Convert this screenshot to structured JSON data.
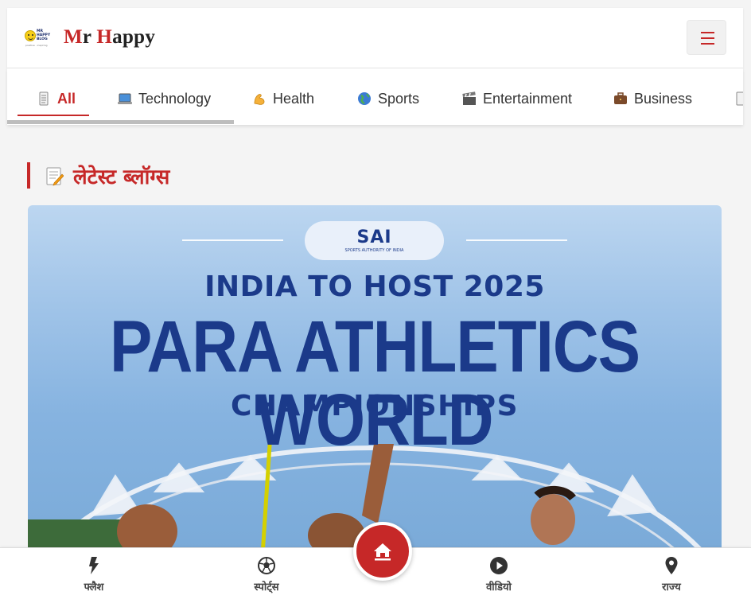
{
  "header": {
    "logo_text": "MR HAPPY BLOG",
    "logo_tagline": "positive · inspiring",
    "brand_first_initial": "M",
    "brand_first_rest": "r ",
    "brand_second_initial": "H",
    "brand_second_rest": "appy",
    "colors": {
      "accent": "#c62828"
    }
  },
  "tabs": [
    {
      "label": "All",
      "icon": "page-icon",
      "active": true
    },
    {
      "label": "Technology",
      "icon": "laptop-icon"
    },
    {
      "label": "Health",
      "icon": "flexed-bicep-icon"
    },
    {
      "label": "Sports",
      "icon": "globe-icon"
    },
    {
      "label": "Entertainment",
      "icon": "clapperboard-icon"
    },
    {
      "label": "Business",
      "icon": "briefcase-icon"
    }
  ],
  "section": {
    "title": "लेटेस्ट ब्लॉग्स",
    "icon": "memo-icon"
  },
  "hero": {
    "badge": "SAI",
    "badge_sub": "SPORTS AUTHORITY OF INDIA",
    "line1": "INDIA TO HOST 2025",
    "line2": "PARA ATHLETICS WORLD",
    "line3": "CHAMPIONSHIPS"
  },
  "bottom_nav": {
    "items": [
      {
        "label": "फ्लैश",
        "icon": "bolt-icon"
      },
      {
        "label": "स्पोर्ट्स",
        "icon": "soccer-ball-icon"
      },
      {
        "label": "वीडियो",
        "icon": "play-circle-icon"
      },
      {
        "label": "राज्य",
        "icon": "location-pin-icon"
      }
    ],
    "home_icon": "home-icon"
  }
}
